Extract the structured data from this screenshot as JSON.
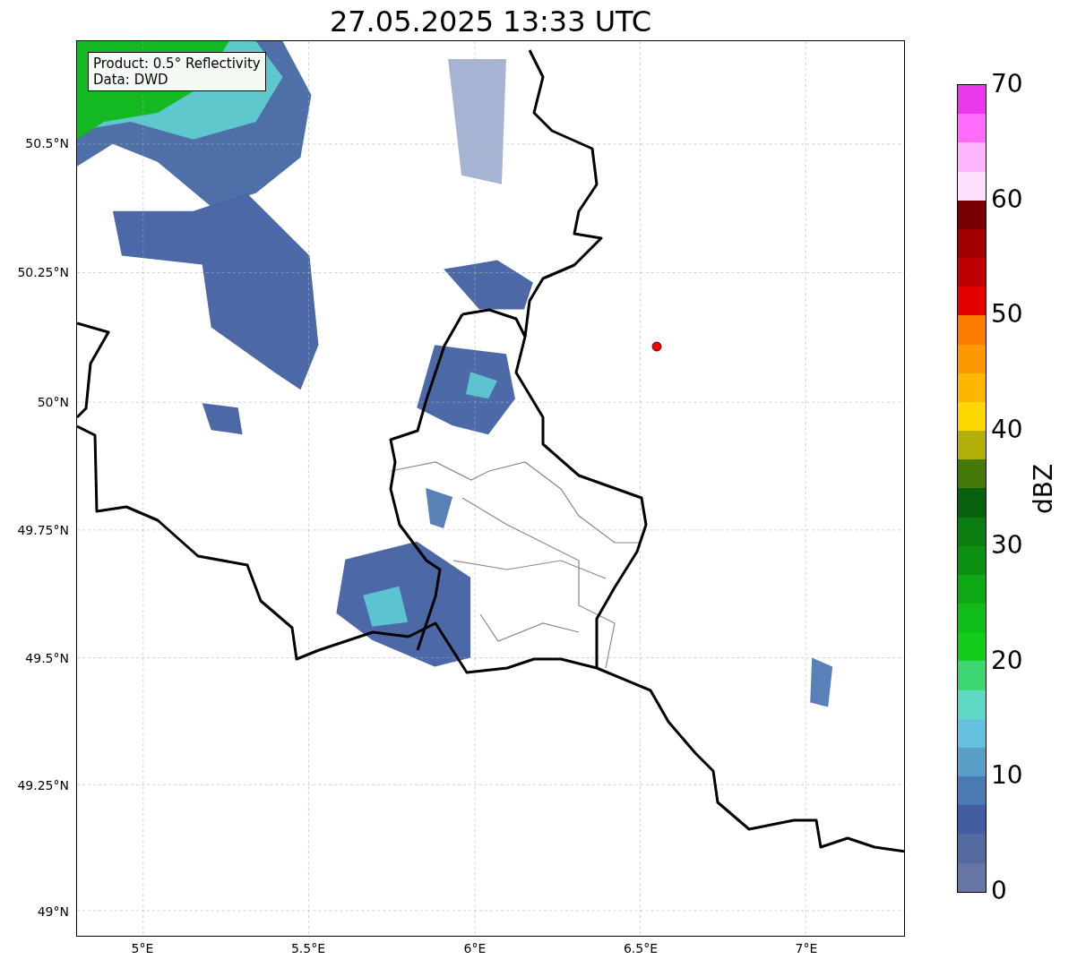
{
  "title": "27.05.2025 13:33 UTC",
  "legend": [
    "Product: 0.5° Reflectivity",
    "Data: DWD"
  ],
  "y_ticks": [
    "50.5°N",
    "50.25°N",
    "50°N",
    "49.75°N",
    "49.5°N",
    "49.25°N",
    "49°N"
  ],
  "x_ticks": [
    "5°E",
    "5.5°E",
    "6°E",
    "6.5°E",
    "7°E"
  ],
  "colorbar": {
    "label": "dBZ",
    "ticks": [
      "70",
      "60",
      "50",
      "40",
      "30",
      "20",
      "10",
      "0"
    ],
    "segments": [
      {
        "color": "#ec38ec"
      },
      {
        "color": "#ff6cfc"
      },
      {
        "color": "#ffb4fc"
      },
      {
        "color": "#ffe0fc"
      },
      {
        "color": "#780000"
      },
      {
        "color": "#a00000"
      },
      {
        "color": "#c00000"
      },
      {
        "color": "#e40000"
      },
      {
        "color": "#fc7c00"
      },
      {
        "color": "#fc9800"
      },
      {
        "color": "#fcb800"
      },
      {
        "color": "#fcd800"
      },
      {
        "color": "#b0b008"
      },
      {
        "color": "#46780a"
      },
      {
        "color": "#06600c"
      },
      {
        "color": "#0a7c10"
      },
      {
        "color": "#0c9012"
      },
      {
        "color": "#0ea814"
      },
      {
        "color": "#10bc18"
      },
      {
        "color": "#12cc1a"
      },
      {
        "color": "#3dd672"
      },
      {
        "color": "#5fd8c4"
      },
      {
        "color": "#64c0dc"
      },
      {
        "color": "#5a9ec8"
      },
      {
        "color": "#4a7ab2"
      },
      {
        "color": "#425ea0"
      },
      {
        "color": "#5469a0"
      },
      {
        "color": "#6674a6"
      }
    ]
  }
}
